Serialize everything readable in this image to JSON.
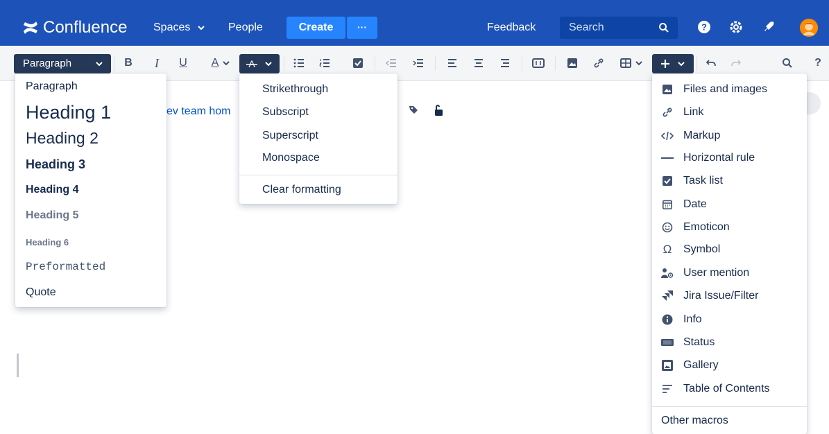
{
  "topnav": {
    "product_name": "Confluence",
    "spaces_label": "Spaces",
    "people_label": "People",
    "create_label": "Create",
    "more_label": "···",
    "feedback_label": "Feedback",
    "search_placeholder": "Search",
    "colors": {
      "bar": "#1d53b8",
      "create": "#2684ff",
      "search": "#0d44a5"
    },
    "icons": [
      "help-icon",
      "settings-icon",
      "notifications-icon",
      "avatar"
    ]
  },
  "toolbar": {
    "paragraph_label": "Paragraph",
    "bold": "B",
    "italic": "I",
    "underline": "U",
    "text_color": "A",
    "help": "?"
  },
  "page": {
    "partial_link_text": "ev team hom"
  },
  "paragraph_menu": {
    "items": [
      "Paragraph",
      "Heading 1",
      "Heading 2",
      "Heading 3",
      "Heading 4",
      "Heading 5",
      "Heading 6",
      "Preformatted",
      "Quote"
    ]
  },
  "format_menu": {
    "items": [
      "Strikethrough",
      "Subscript",
      "Superscript",
      "Monospace"
    ],
    "clear": "Clear formatting"
  },
  "insert_menu": {
    "items": [
      {
        "label": "Files and images",
        "icon": "image-icon"
      },
      {
        "label": "Link",
        "icon": "link-icon"
      },
      {
        "label": "Markup",
        "icon": "markup-icon"
      },
      {
        "label": "Horizontal rule",
        "icon": "horizontal-rule-icon"
      },
      {
        "label": "Task list",
        "icon": "task-list-icon"
      },
      {
        "label": "Date",
        "icon": "calendar-icon"
      },
      {
        "label": "Emoticon",
        "icon": "emoticon-icon"
      },
      {
        "label": "Symbol",
        "icon": "omega-icon"
      },
      {
        "label": "User mention",
        "icon": "user-mention-icon"
      },
      {
        "label": "Jira Issue/Filter",
        "icon": "jira-icon"
      },
      {
        "label": "Info",
        "icon": "info-icon"
      },
      {
        "label": "Status",
        "icon": "status-icon"
      },
      {
        "label": "Gallery",
        "icon": "gallery-icon"
      },
      {
        "label": "Table of Contents",
        "icon": "table-of-contents-icon"
      }
    ],
    "other": "Other macros"
  }
}
